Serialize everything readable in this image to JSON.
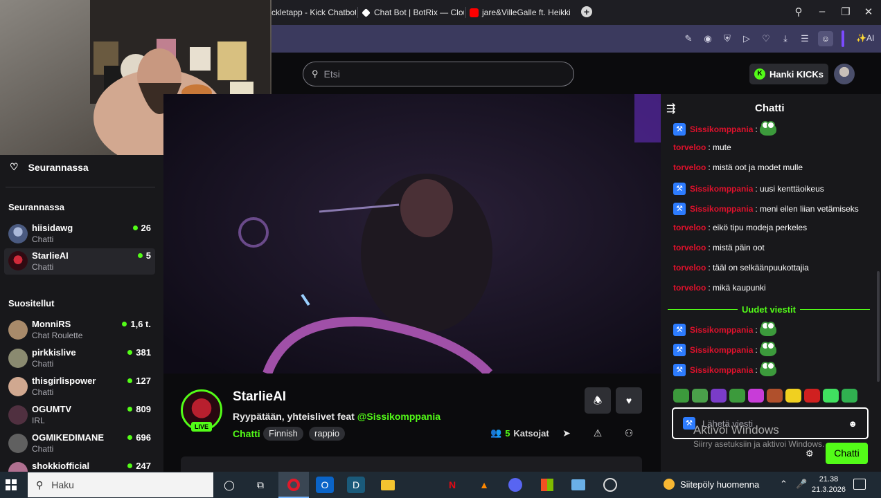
{
  "browser": {
    "tabs": [
      {
        "label": "ckletapp - Kick Chatbot",
        "icon": "bot-favicon",
        "color": "#3b82f6"
      },
      {
        "label": "Chat Bot | BotRix — Cloud",
        "icon": "botrix-favicon",
        "color": "#ffffff"
      },
      {
        "label": "jare&VilleGalle ft. Heikki K",
        "icon": "youtube-favicon",
        "color": "#ff0000"
      }
    ],
    "ai_label": "AI"
  },
  "header": {
    "search_placeholder": "Etsi",
    "get_kicks_label": "Hanki KICKs"
  },
  "sidebar": {
    "following_title": "Seurannassa",
    "followed_section": "Seurannassa",
    "followed": [
      {
        "name": "hiisidawg",
        "category": "Chatti",
        "viewers": "26",
        "color": "#7a8bb0"
      },
      {
        "name": "StarlieAI",
        "category": "Chatti",
        "viewers": "5",
        "color": "#b81f2e",
        "active": true
      }
    ],
    "recommended_section": "Suositellut",
    "recommended": [
      {
        "name": "MonniRS",
        "category": "Chat Roulette",
        "viewers": "1,6 t.",
        "color": "#a88a6a"
      },
      {
        "name": "pirkkislive",
        "category": "Chatti",
        "viewers": "381",
        "color": "#8a8a70"
      },
      {
        "name": "thisgirlispower",
        "category": "Chatti",
        "viewers": "127",
        "color": "#d0a890"
      },
      {
        "name": "OGUMTV",
        "category": "IRL",
        "viewers": "809",
        "color": "#503040"
      },
      {
        "name": "OGMIKEDIMANE",
        "category": "Chatti",
        "viewers": "696",
        "color": "#606060"
      },
      {
        "name": "shokkiofficial",
        "category": "",
        "viewers": "247",
        "color": "#b07090"
      }
    ]
  },
  "stream": {
    "channel": "StarlieAI",
    "live_label": "LIVE",
    "title": "Ryypätään, yhteislivet feat ",
    "mention": "@Sissikomppania",
    "category": "Chatti",
    "tags": [
      "Finnish",
      "rappio"
    ],
    "viewers": "5",
    "viewers_label": "Katsojat"
  },
  "chat": {
    "title": "Chatti",
    "messages": [
      {
        "user": "Sissikomppania",
        "text": "",
        "badge": true,
        "emote": true
      },
      {
        "user": "torveloo",
        "text": ": mute",
        "badge": false
      },
      {
        "user": "torveloo",
        "text": ": mistä oot ja modet mulle",
        "badge": false
      },
      {
        "user": "Sissikomppania",
        "text": ": uusi kenttäoikeus",
        "badge": true
      },
      {
        "user": "Sissikomppania",
        "text": ": meni eilen liian vetämiseks",
        "badge": true
      },
      {
        "user": "torveloo",
        "text": ": eikö tipu modeja perkeles",
        "badge": false
      },
      {
        "user": "torveloo",
        "text": ": mistä päin oot",
        "badge": false
      },
      {
        "user": "torveloo",
        "text": ": tääl on selkäänpuukottajia",
        "badge": false
      },
      {
        "user": "torveloo",
        "text": ": mikä kaupunki",
        "badge": false
      }
    ],
    "new_messages_label": "Uudet viestit",
    "new_messages": [
      {
        "user": "Sissikomppania",
        "text": "",
        "badge": true,
        "emote": true
      },
      {
        "user": "Sissikomppania",
        "text": "",
        "badge": true,
        "emote": true
      },
      {
        "user": "Sissikomppania",
        "text": "",
        "badge": true,
        "emote": true
      }
    ],
    "input_placeholder": "Lähetä viesti",
    "send_label": "Chatti",
    "emote_colors": [
      "#3c9a3c",
      "#4aa04a",
      "#7a3cc8",
      "#3c9a3c",
      "#c83cd8",
      "#b0502c",
      "#f0d020",
      "#d02020",
      "#40e060",
      "#30b050"
    ]
  },
  "watermark": {
    "line1": "Aktivoi Windows",
    "line2": "Siirry asetuksiin ja aktivoi Windows."
  },
  "taskbar": {
    "search_placeholder": "Haku",
    "weather": "Siitepöly huomenna",
    "time": "21.38",
    "date": "21.3.2026"
  }
}
